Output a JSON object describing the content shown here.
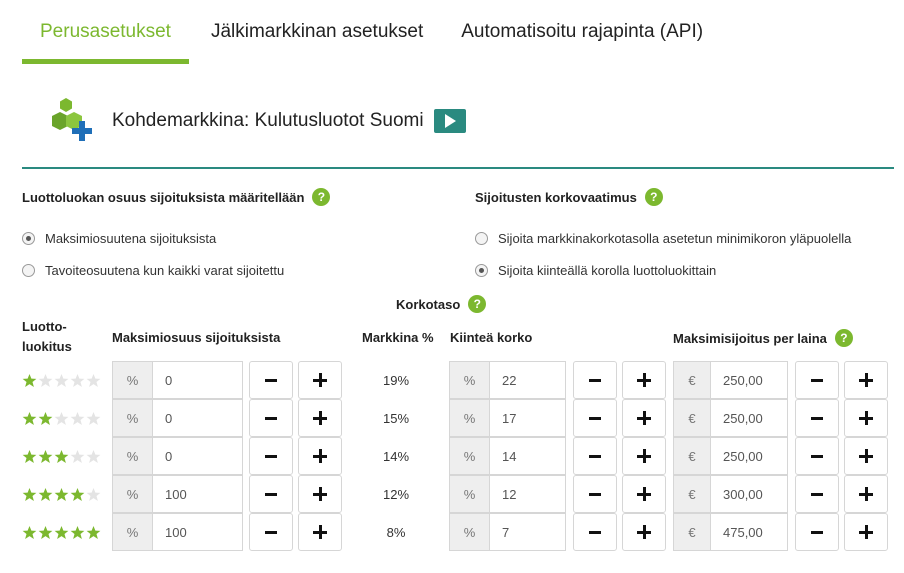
{
  "tabs": [
    {
      "label": "Perusasetukset",
      "active": true
    },
    {
      "label": "Jälkimarkkinan asetukset",
      "active": false
    },
    {
      "label": "Automatisoitu rajapinta (API)",
      "active": false
    }
  ],
  "market": {
    "label": "Kohdemarkkina: Kulutusluotot Suomi"
  },
  "share_section": {
    "heading": "Luottoluokan osuus sijoituksista määritellään",
    "options": [
      {
        "label": "Maksimiosuutena sijoituksista",
        "selected": true
      },
      {
        "label": "Tavoiteosuutena kun kaikki varat sijoitettu",
        "selected": false
      }
    ]
  },
  "rate_section": {
    "heading": "Sijoitusten korkovaatimus",
    "options": [
      {
        "label": "Sijoita markkinakorkotasolla asetetun minimikoron yläpuolella",
        "selected": false
      },
      {
        "label": "Sijoita kiinteällä korolla luottoluokittain",
        "selected": true
      }
    ]
  },
  "table": {
    "korkotaso_label": "Korkotaso",
    "headers": {
      "rating_line1": "Luotto-",
      "rating_line2": "luokitus",
      "max_share": "Maksimiosuus sijoituksista",
      "market_pct": "Markkina %",
      "fixed_rate": "Kiinteä korko",
      "max_investment": "Maksimisijoitus per laina"
    },
    "rows": [
      {
        "stars": 1,
        "share_unit": "%",
        "share": "0",
        "market": "19%",
        "rate_unit": "%",
        "rate": "22",
        "inv_unit": "€",
        "investment": "250,00"
      },
      {
        "stars": 2,
        "share_unit": "%",
        "share": "0",
        "market": "15%",
        "rate_unit": "%",
        "rate": "17",
        "inv_unit": "€",
        "investment": "250,00"
      },
      {
        "stars": 3,
        "share_unit": "%",
        "share": "0",
        "market": "14%",
        "rate_unit": "%",
        "rate": "14",
        "inv_unit": "€",
        "investment": "250,00"
      },
      {
        "stars": 4,
        "share_unit": "%",
        "share": "100",
        "market": "12%",
        "rate_unit": "%",
        "rate": "12",
        "inv_unit": "€",
        "investment": "300,00"
      },
      {
        "stars": 5,
        "share_unit": "%",
        "share": "100",
        "market": "8%",
        "rate_unit": "%",
        "rate": "7",
        "inv_unit": "€",
        "investment": "475,00"
      }
    ]
  },
  "colors": {
    "accent": "#7cb82f",
    "teal": "#2a8a80",
    "star_empty": "#e4e4e4",
    "icon_blue": "#1f6fb8"
  },
  "icons": {
    "help": "question-icon",
    "play": "play-icon",
    "market": "market-add-icon",
    "star": "star-icon"
  }
}
